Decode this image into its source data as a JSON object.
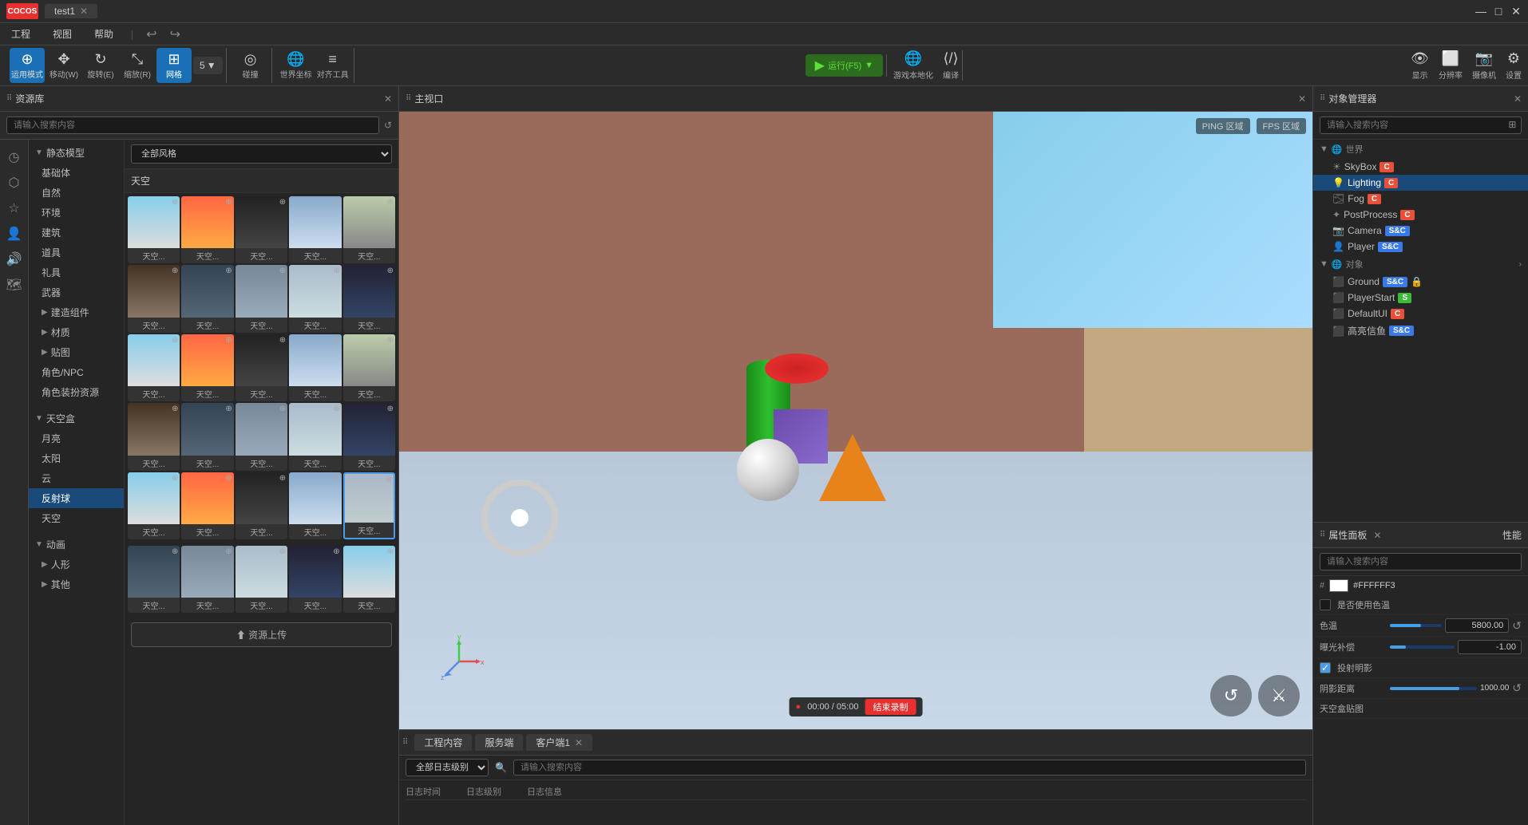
{
  "app": {
    "logo": "COCOS",
    "tab": "test1",
    "window_controls": [
      "—",
      "□",
      "✕"
    ]
  },
  "menu": {
    "items": [
      "工程",
      "视图",
      "帮助"
    ]
  },
  "toolbar": {
    "mode_label": "运用模式",
    "move_label": "移动(W)",
    "rotate_label": "旋转(E)",
    "scale_label": "缩放(R)",
    "grid_label": "网格",
    "grid_value": "5",
    "collision_label": "碰撞",
    "world_orient_label": "世界坐标",
    "align_label": "对齐工具",
    "run_label": "运行(F5)",
    "localize_label": "游戏本地化",
    "compile_label": "编译",
    "display_label": "显示",
    "resolution_label": "分辨率",
    "camera_label": "摄像机",
    "settings_label": "设置"
  },
  "asset_panel": {
    "title": "资源库",
    "search_placeholder": "请输入搜索内容",
    "style_options": [
      "全部风格"
    ],
    "selected_style": "全部风格",
    "section_sky": "天空",
    "categories": [
      {
        "label": "静态模型",
        "expanded": true
      },
      {
        "label": "基础体"
      },
      {
        "label": "自然"
      },
      {
        "label": "环境"
      },
      {
        "label": "建筑"
      },
      {
        "label": "道具"
      },
      {
        "label": "礼具"
      },
      {
        "label": "武器"
      },
      {
        "label": "建造组件",
        "has_children": true
      },
      {
        "label": "材质",
        "has_children": true
      },
      {
        "label": "贴图",
        "has_children": true
      },
      {
        "label": "角色/NPC"
      },
      {
        "label": "角色装扮资源"
      },
      {
        "label": "天空盒",
        "expanded": true
      },
      {
        "label": "月亮"
      },
      {
        "label": "太阳"
      },
      {
        "label": "云"
      },
      {
        "label": "反射球",
        "selected": true
      },
      {
        "label": "天空"
      },
      {
        "label": "动画",
        "has_children": true
      },
      {
        "label": "人形",
        "has_children": true
      },
      {
        "label": "其他",
        "has_children": true
      }
    ],
    "thumbnails": [
      {
        "label": "天空...",
        "style": "sky1"
      },
      {
        "label": "天空...",
        "style": "sky2"
      },
      {
        "label": "天空...",
        "style": "sky3"
      },
      {
        "label": "天空...",
        "style": "sky4"
      },
      {
        "label": "天空...",
        "style": "sky5"
      },
      {
        "label": "天空...",
        "style": "sky6"
      },
      {
        "label": "天空...",
        "style": "sky7"
      },
      {
        "label": "天空...",
        "style": "sky8"
      },
      {
        "label": "天空...",
        "style": "sky9"
      },
      {
        "label": "天空...",
        "style": "sky10"
      },
      {
        "label": "天空...",
        "style": "sky1"
      },
      {
        "label": "天空...",
        "style": "sky2"
      },
      {
        "label": "天空...",
        "style": "sky3"
      },
      {
        "label": "天空...",
        "style": "sky4"
      },
      {
        "label": "天空...",
        "style": "sky5"
      },
      {
        "label": "天空...",
        "style": "sky6"
      },
      {
        "label": "天空...",
        "style": "sky7"
      },
      {
        "label": "天空...",
        "style": "sky8"
      },
      {
        "label": "天空...",
        "style": "sky9"
      },
      {
        "label": "天空...",
        "style": "sky10"
      },
      {
        "label": "天空...",
        "style": "sky1"
      },
      {
        "label": "天空...",
        "style": "sky2"
      },
      {
        "label": "天空...",
        "style": "sky3"
      },
      {
        "label": "天空...",
        "style": "sky4"
      },
      {
        "label": "天空...",
        "style": "sky5",
        "selected": true
      }
    ],
    "upload_label": "⬆ 资源上传"
  },
  "viewport": {
    "title": "主视口",
    "ping_label": "PING 区域",
    "fps_label": "FPS 区域"
  },
  "bottom_panel": {
    "tabs": [
      "工程内容",
      "服务端",
      "客户端1"
    ],
    "log_filter_label": "全部日志级别",
    "log_search_placeholder": "请输入搜索内容",
    "col_time": "日志时间",
    "col_level": "日志级别",
    "col_msg": "日志信息"
  },
  "video_bar": {
    "time": "00:00 / 05:00",
    "end_label": "结束录制"
  },
  "obj_manager": {
    "title": "对象管理器",
    "search_placeholder": "请输入搜索内容",
    "world_label": "世界",
    "objects": [
      {
        "label": "SkyBox",
        "badge": "C",
        "badge_type": "c"
      },
      {
        "label": "Lighting",
        "badge": "C",
        "badge_type": "c",
        "selected": true
      },
      {
        "label": "Fog",
        "badge": "C",
        "badge_type": "c"
      },
      {
        "label": "PostProcess",
        "badge": "C",
        "badge_type": "c"
      },
      {
        "label": "Camera",
        "badge": "S&C",
        "badge_type": "sc"
      },
      {
        "label": "Player",
        "badge": "S&C",
        "badge_type": "sc"
      }
    ],
    "obj_section": "对象",
    "obj_items": [
      {
        "label": "Ground",
        "badge": "S&C",
        "badge_type": "sc",
        "lock": true
      },
      {
        "label": "PlayerStart",
        "badge": "S",
        "badge_type": "s"
      },
      {
        "label": "DefaultUI",
        "badge": "C",
        "badge_type": "c"
      },
      {
        "label": "高亮信鱼",
        "badge": "S&C",
        "badge_type": "sc"
      }
    ]
  },
  "props_panel": {
    "title": "属性面板",
    "perf_tab": "性能",
    "search_placeholder": "请输入搜索内容",
    "color_hex": "#FFFFFF3",
    "use_color_temp_label": "是否使用色温",
    "color_temp_label": "色温",
    "color_temp_value": "5800.00",
    "exposure_label": "曝光补偿",
    "exposure_value": "-1.00",
    "cast_shadow_label": "投射明影",
    "cast_shadow_checked": true,
    "shadow_dist_label": "阴影距离",
    "shadow_dist_value": "1000.00",
    "skybox_label": "天空盒贴图"
  },
  "player_start": {
    "label": "Player Start"
  }
}
